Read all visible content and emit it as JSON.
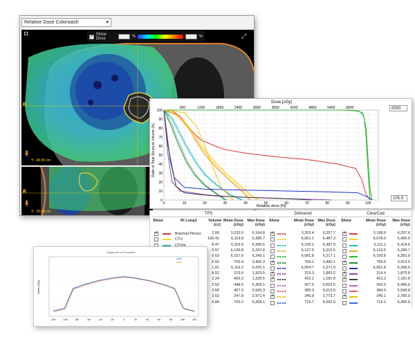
{
  "ct_viewer": {
    "colorwash_select": "Relative Dose Colorwash",
    "show_dose_label": "Show Dose",
    "pct_unit_left": "%",
    "pct_unit_right": "%",
    "axial_left_marker": "R",
    "axial_right_marker": "L",
    "axial_position": "Y: -49.06 cm",
    "coronal_left_marker": "R",
    "coronal_position": "Y: -29.24 cm"
  },
  "dvh": {
    "top_axis_title": "Dose [cGy]",
    "top_ticks": [
      "600",
      "1200",
      "1800",
      "2400",
      "3000",
      "3600",
      "4200",
      "4800",
      "5400",
      "6000"
    ],
    "top_value_field": "6593",
    "y_axis_title": "Ratio of Total Structure Volume [%]",
    "y_ticks": [
      "100",
      "90",
      "80",
      "70",
      "60",
      "50",
      "40",
      "30",
      "20",
      "10",
      "0"
    ],
    "x_axis_title": "Relative dose [%]",
    "x_ticks": [
      "0",
      "10",
      "20",
      "30",
      "40",
      "50",
      "60",
      "70",
      "80",
      "90",
      "100"
    ],
    "bottom_value_field": "105.9"
  },
  "chart_data": {
    "type": "line",
    "xlabel": "Relative dose [%]",
    "ylabel": "Ratio of Total Structure Volume [%]",
    "xlim": [
      0,
      105
    ],
    "ylim": [
      0,
      100
    ],
    "grid": true,
    "series": [
      {
        "color": "#e03030",
        "x": [
          0,
          4,
          8,
          12,
          18,
          25,
          30,
          40,
          55,
          70,
          85,
          94,
          97,
          99,
          101
        ],
        "y": [
          100,
          99,
          93,
          80,
          67,
          60,
          56,
          52,
          48,
          45,
          40,
          35,
          22,
          6,
          0
        ]
      },
      {
        "color": "#20c020",
        "x": [
          0,
          88,
          94,
          96,
          97,
          98,
          99,
          100,
          101,
          102
        ],
        "y": [
          100,
          100,
          99,
          98,
          96,
          92,
          80,
          45,
          10,
          0
        ]
      },
      {
        "color": "#40a840",
        "x": [
          0,
          90,
          95,
          97,
          98,
          99,
          100,
          101
        ],
        "y": [
          100,
          100,
          99,
          97,
          93,
          70,
          30,
          0
        ]
      },
      {
        "color": "#ffd020",
        "x": [
          0,
          8,
          14,
          18,
          24,
          30,
          36,
          42,
          46
        ],
        "y": [
          100,
          92,
          75,
          60,
          44,
          30,
          18,
          6,
          0
        ]
      },
      {
        "color": "#f0a030",
        "x": [
          0,
          6,
          12,
          16,
          20,
          26,
          32,
          38,
          42
        ],
        "y": [
          100,
          95,
          80,
          64,
          50,
          35,
          22,
          10,
          0
        ]
      },
      {
        "color": "#28b6c8",
        "x": [
          0,
          4,
          8,
          12,
          16,
          20,
          26,
          32,
          38
        ],
        "y": [
          100,
          90,
          72,
          55,
          40,
          28,
          16,
          6,
          0
        ]
      },
      {
        "color": "#1f8a3a",
        "x": [
          0,
          3,
          7,
          11,
          15,
          20,
          26,
          30
        ],
        "y": [
          100,
          85,
          62,
          42,
          28,
          16,
          6,
          0
        ]
      },
      {
        "color": "#2030d0",
        "x": [
          0,
          2,
          5,
          10,
          20,
          40,
          60,
          80,
          95,
          100,
          102
        ],
        "y": [
          100,
          60,
          25,
          14,
          12,
          11,
          10,
          9,
          8,
          3,
          0
        ]
      },
      {
        "color": "#9040c0",
        "x": [
          0,
          2,
          4,
          8,
          14,
          20,
          30,
          45,
          60,
          75,
          82
        ],
        "y": [
          100,
          50,
          20,
          10,
          8,
          6,
          4,
          2.5,
          1.5,
          0.5,
          0
        ]
      },
      {
        "color": "#404040",
        "x": [
          0,
          3,
          6,
          10,
          18,
          28,
          40,
          55,
          65,
          72
        ],
        "y": [
          100,
          45,
          15,
          8,
          6,
          4,
          3,
          2,
          1,
          0
        ]
      },
      {
        "color": "#e6c400",
        "x": [
          0,
          10,
          16,
          20,
          24,
          28,
          34
        ],
        "y": [
          100,
          97,
          82,
          60,
          36,
          14,
          0
        ]
      }
    ]
  },
  "table": {
    "tps_title": "TPS",
    "delivered_title": "Delivered",
    "clearcalc_title": "ClearCalc",
    "show_header": "Show",
    "structure_header": "Rt Lung1",
    "volume_header": "Volume",
    "volume_unit": "(cc)",
    "mean_dose_header": "Mean Dose",
    "max_dose_header": "Max Dose",
    "dose_unit": "(cGy)",
    "rows": [
      {
        "name": "Brachial Plexus",
        "color": "#e03030",
        "vol": "2.66",
        "mean": "3,232.0",
        "max": "6,164.8",
        "d_mean": "3,263.4",
        "d_max": "6,257.7",
        "c_mean": "3,198.0",
        "c_max": "6,297.6",
        "show": true,
        "d_show": true,
        "c_show": true
      },
      {
        "name": "CTV",
        "color": "#ffd020",
        "vol": "166.41",
        "mean": "6,119.8",
        "max": "6,385.7",
        "d_mean": "6,061.1",
        "d_max": "6,487.3",
        "c_mean": "6,078.0",
        "c_max": "6,495.9",
        "show": false,
        "d_show": false,
        "c_show": false
      },
      {
        "name": "CTVm",
        "color": "#28b6c8",
        "vol": "8.47",
        "mean": "6,116.9",
        "max": "6,380.6",
        "d_mean": "6,105.2",
        "d_max": "6,387.9",
        "c_mean": "6,111.1",
        "c_max": "6,418.6",
        "show": false,
        "d_show": false,
        "c_show": false
      },
      {
        "name": "",
        "color": "#f0a030",
        "vol": "0.97",
        "mean": "6,145.8",
        "max": "6,247.8",
        "d_mean": "6,127.5",
        "d_max": "6,315.5",
        "c_mean": "6,123.5",
        "c_max": "6,280.7",
        "show": false,
        "d_show": false,
        "c_show": false
      },
      {
        "name": "",
        "color": "#20c020",
        "vol": "0.63",
        "mean": "6,157.6",
        "max": "6,249.1",
        "d_mean": "6,081.8",
        "d_max": "6,217.1",
        "c_mean": "6,100.8",
        "c_max": "6,281.9",
        "show": false,
        "d_show": false,
        "c_show": false
      },
      {
        "name": "",
        "color": "#1f8a3a",
        "vol": "6.50",
        "mean": "705.4",
        "max": "3,466.3",
        "d_mean": "756.2",
        "d_max": "3,460.1",
        "c_mean": "755.5",
        "c_max": "3,413.0",
        "show": true,
        "d_show": true,
        "c_show": true
      },
      {
        "name": "",
        "color": "#2030d0",
        "vol": "1.01",
        "mean": "6,116.2",
        "max": "6,292.1",
        "d_mean": "6,054.7",
        "d_max": "6,371.9",
        "c_mean": "6,051.8",
        "c_max": "6,368.0",
        "show": false,
        "d_show": false,
        "c_show": false
      },
      {
        "name": "",
        "color": "#9040c0",
        "vol": "8.52",
        "mean": "223.6",
        "max": "1,923.5",
        "d_mean": "215.3",
        "d_max": "1,883.2",
        "c_mean": "214.4",
        "c_max": "1,875.8",
        "show": true,
        "d_show": true,
        "c_show": true
      },
      {
        "name": "",
        "color": "#404040",
        "vol": "2.24",
        "mean": "465.3",
        "max": "1,226.5",
        "d_mean": "415.1",
        "d_max": "1,181.8",
        "c_mean": "413.2",
        "c_max": "1,181.8",
        "show": true,
        "d_show": true,
        "c_show": true
      },
      {
        "name": "",
        "color": "#c060c0",
        "vol": "2.52",
        "mean": "448.6",
        "max": "6,358.1",
        "d_mean": "427.0",
        "d_max": "6,592.5",
        "c_mean": "426.6",
        "c_max": "6,489.6",
        "show": false,
        "d_show": false,
        "c_show": false
      },
      {
        "name": "",
        "color": "#e06060",
        "vol": "3.68",
        "mean": "407.0",
        "max": "5,565.3",
        "d_mean": "385.3",
        "d_max": "5,610.9",
        "c_mean": "384.9",
        "c_max": "5,598.8",
        "show": false,
        "d_show": false,
        "c_show": false
      },
      {
        "name": "",
        "color": "#e6c400",
        "vol": "3.62",
        "mean": "247.8",
        "max": "2,971.4",
        "d_mean": "245.8",
        "d_max": "2,773.7",
        "c_mean": "245.1",
        "c_max": "2,786.9",
        "show": true,
        "d_show": true,
        "c_show": true
      },
      {
        "name": "",
        "color": "#4060d0",
        "vol": "6.84",
        "mean": "720.2",
        "max": "6,358.1",
        "d_mean": "716.7",
        "d_max": "6,592.5",
        "c_mean": "716.2",
        "c_max": "6,490.9",
        "show": false,
        "d_show": false,
        "c_show": false
      }
    ]
  },
  "profile": {
    "title": "Measured vs Predicted",
    "legend_a": "Meas",
    "legend_b": "Predicted",
    "y_axis_title": "Dose (cGy)",
    "x_ticks": [
      "-120",
      "-100",
      "-80",
      "-60",
      "-40",
      "-20",
      "0",
      "20",
      "40",
      "60",
      "80",
      "100",
      "120"
    ]
  },
  "colors": {
    "panel_shadow": "#000000",
    "ct_bg": "#000000",
    "dose_green": "#40e060",
    "dose_cyan": "#30c8e0"
  }
}
